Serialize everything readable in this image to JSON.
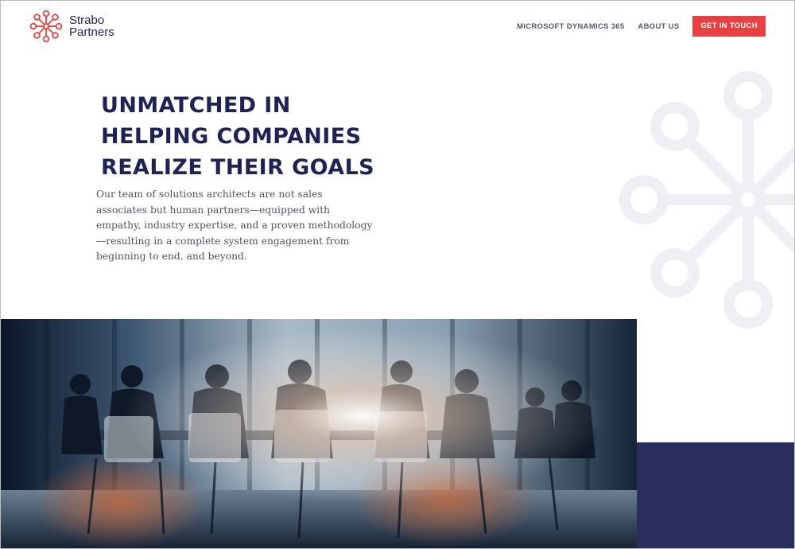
{
  "brand": {
    "name_line1": "Strabo",
    "name_line2": "Partners",
    "icon": "network-hub-icon",
    "accent_color": "#e84141"
  },
  "nav": {
    "links": [
      {
        "label": "MICROSOFT DYNAMICS 365"
      },
      {
        "label": "ABOUT US"
      }
    ],
    "cta_label": "GET IN TOUCH"
  },
  "hero": {
    "title_lines": [
      "UNMATCHED IN",
      "HELPING COMPANIES",
      "REALIZE THEIR GOALS"
    ],
    "body": "Our team of solutions architects are not sales associates but human partners—equipped with empathy, industry expertise, and a proven methodology—resulting in a complete system engagement from beginning to end, and beyond.",
    "title_color": "#1e2356"
  },
  "media": {
    "photo": "business-meeting-silhouette-image",
    "block_color": "#2a2e5c"
  }
}
